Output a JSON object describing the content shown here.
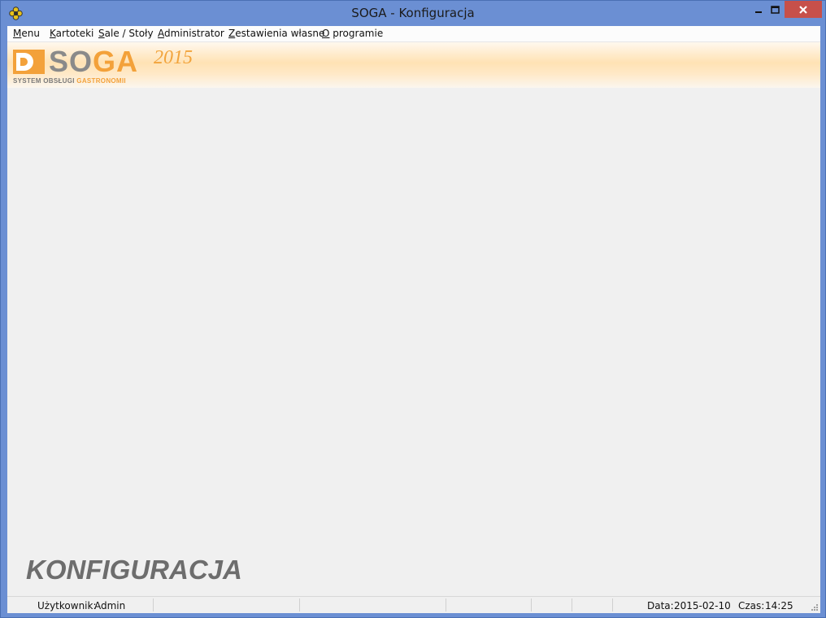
{
  "window": {
    "title": "SOGA - Konfiguracja",
    "controls": {
      "minimize": "▁",
      "maximize": "□",
      "close": "✕"
    }
  },
  "menu": {
    "items": [
      {
        "label": "Menu",
        "accel": "M"
      },
      {
        "label": "Kartoteki",
        "accel": "K"
      },
      {
        "label": "Sale / Stoły",
        "accel": "S"
      },
      {
        "label": "Administrator",
        "accel": "A"
      },
      {
        "label": "Zestawienia własne",
        "accel": "Z"
      },
      {
        "label": "O programie",
        "accel": "O"
      }
    ]
  },
  "banner": {
    "logo_letters_grey": "SO",
    "logo_letters_orange": "GA",
    "year": "2015",
    "tagline_grey": "SYSTEM OBSŁUGI",
    "tagline_orange": "GASTRONOMII",
    "colors": {
      "orange": "#f3a13a",
      "grey": "#8a8a8a"
    }
  },
  "main": {
    "module_title": "KONFIGURACJA"
  },
  "status": {
    "user_label": "Użytkownik:",
    "user_value": "Admin",
    "date_label": "Data:",
    "date_value": "2015-02-10",
    "time_label": "Czas:",
    "time_value": "14:25"
  }
}
